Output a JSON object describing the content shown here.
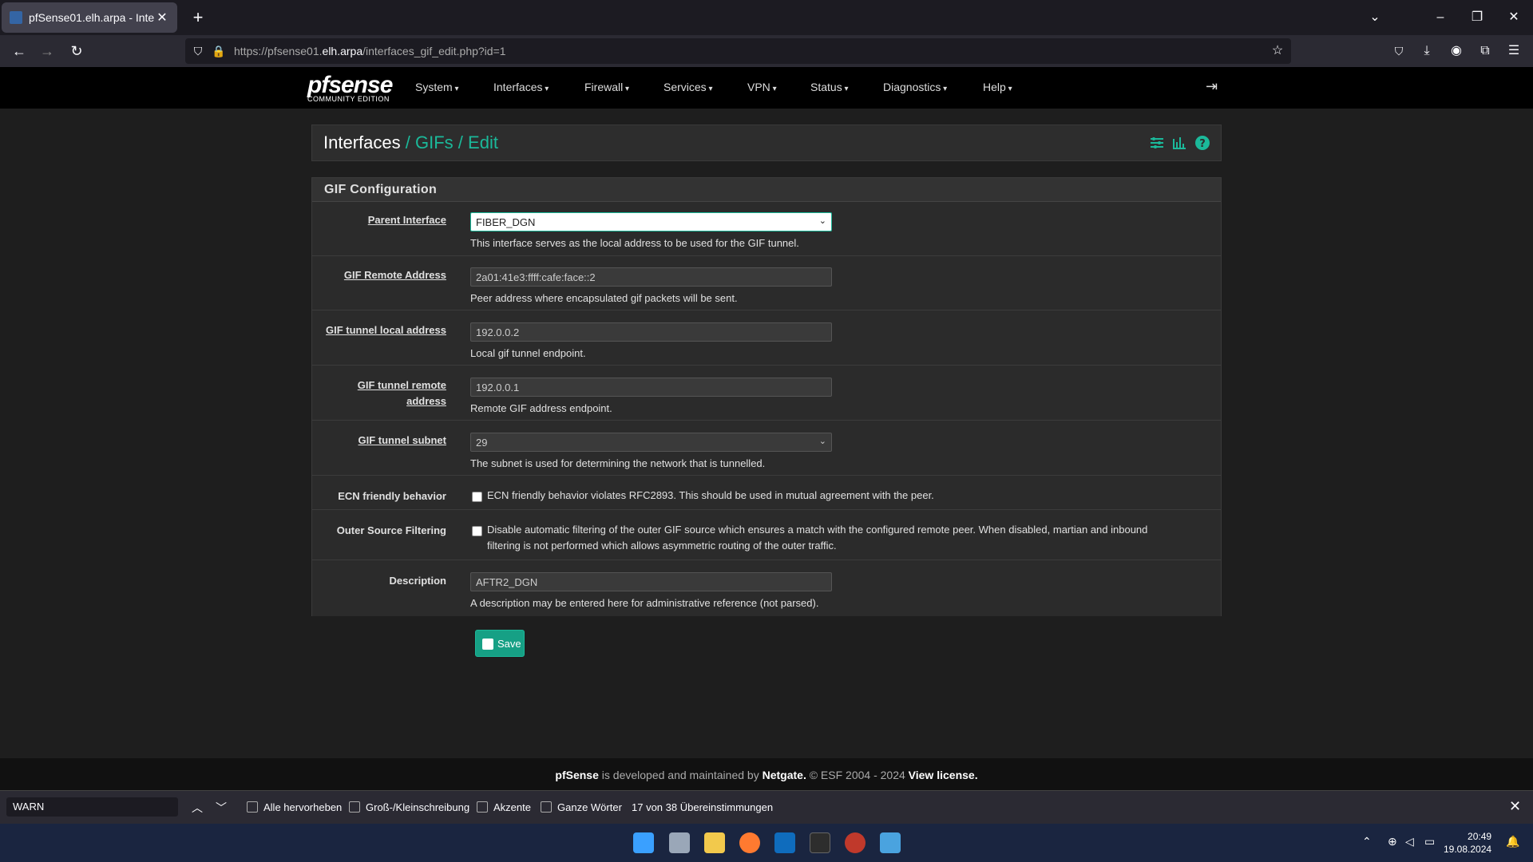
{
  "browser": {
    "tab_title": "pfSense01.elh.arpa - Interfaces",
    "url_prefix": "https://pfsense01.",
    "url_host": "elh.arpa",
    "url_path": "/interfaces_gif_edit.php?id=1"
  },
  "nav": {
    "logo_text": "pfsense",
    "logo_sub": "COMMUNITY EDITION",
    "menus": [
      "System",
      "Interfaces",
      "Firewall",
      "Services",
      "VPN",
      "Status",
      "Diagnostics",
      "Help"
    ]
  },
  "breadcrumb": {
    "root": "Interfaces",
    "sep": "/",
    "level2": "GIFs",
    "level3": "Edit"
  },
  "panel": {
    "title": "GIF Configuration"
  },
  "form": {
    "parent_interface": {
      "label": "Parent Interface",
      "value": "FIBER_DGN",
      "help": "This interface serves as the local address to be used for the GIF tunnel."
    },
    "remote_address": {
      "label": "GIF Remote Address",
      "value": "2a01:41e3:ffff:cafe:face::2",
      "help": "Peer address where encapsulated gif packets will be sent."
    },
    "tunnel_local": {
      "label": "GIF tunnel local address",
      "value": "192.0.0.2",
      "help": "Local gif tunnel endpoint."
    },
    "tunnel_remote": {
      "label_line1": "GIF tunnel remote",
      "label_line2": "address",
      "value": "192.0.0.1",
      "help": "Remote GIF address endpoint."
    },
    "tunnel_subnet": {
      "label": "GIF tunnel subnet",
      "value": "29",
      "help": "The subnet is used for determining the network that is tunnelled."
    },
    "ecn": {
      "label": "ECN friendly behavior",
      "text": "ECN friendly behavior violates RFC2893. This should be used in mutual agreement with the peer."
    },
    "outer_filter": {
      "label": "Outer Source Filtering",
      "text_line1": "Disable automatic filtering of the outer GIF source which ensures a match with the configured remote peer. When disabled, martian and inbound",
      "text_line2": "filtering is not performed which allows asymmetric routing of the outer traffic."
    },
    "description": {
      "label": "Description",
      "value": "AFTR2_DGN",
      "help": "A description may be entered here for administrative reference (not parsed)."
    },
    "save_label": "Save"
  },
  "footer": {
    "brand": "pfSense",
    "mid": " is developed and maintained by ",
    "company": "Netgate.",
    "copy": " © ESF 2004 - 2024 ",
    "license": "View license."
  },
  "findbar": {
    "query": "WARN",
    "highlight_all": "Alle hervorheben",
    "match_case": "Groß-/Kleinschreibung",
    "accents": "Akzente",
    "whole_words": "Ganze Wörter",
    "status": "17 von 38 Übereinstimmungen"
  },
  "taskbar": {
    "time": "20:49",
    "date": "19.08.2024"
  },
  "colors": {
    "accent": "#1bb99a",
    "save": "#16a085",
    "nav_bg": "#000000"
  }
}
